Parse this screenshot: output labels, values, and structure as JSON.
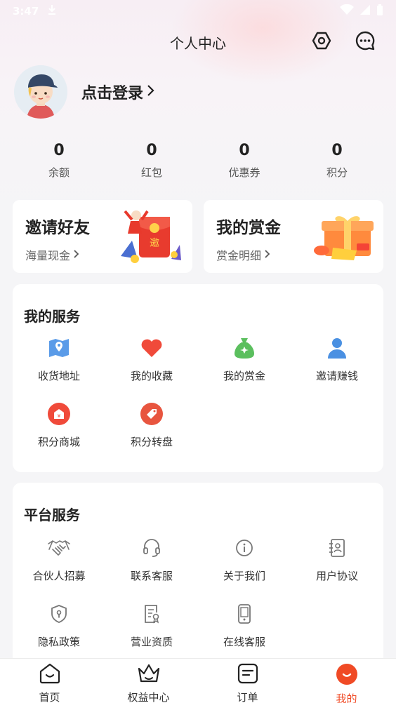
{
  "status_bar": {
    "time": "3:47"
  },
  "header": {
    "title": "个人中心",
    "settings_icon": "settings-hexagon-icon",
    "message_icon": "chat-bubble-icon"
  },
  "profile": {
    "login_text": "点击登录",
    "chevron": "›"
  },
  "stats": [
    {
      "value": "0",
      "label": "余额"
    },
    {
      "value": "0",
      "label": "红包"
    },
    {
      "value": "0",
      "label": "优惠券"
    },
    {
      "value": "0",
      "label": "积分"
    }
  ],
  "promos": [
    {
      "title": "邀请好友",
      "subtitle": "海量现金",
      "art_text": "邀"
    },
    {
      "title": "我的赏金",
      "subtitle": "赏金明细"
    }
  ],
  "my_services": {
    "title": "我的服务",
    "items": [
      {
        "label": "收货地址",
        "icon": "map-pin-icon"
      },
      {
        "label": "我的收藏",
        "icon": "heart-icon"
      },
      {
        "label": "我的赏金",
        "icon": "money-bag-icon"
      },
      {
        "label": "邀请赚钱",
        "icon": "user-icon"
      },
      {
        "label": "积分商城",
        "icon": "store-icon"
      },
      {
        "label": "积分转盘",
        "icon": "tag-icon"
      }
    ]
  },
  "platform_services": {
    "title": "平台服务",
    "items": [
      {
        "label": "合伙人招募",
        "icon": "handshake-icon"
      },
      {
        "label": "联系客服",
        "icon": "headset-icon"
      },
      {
        "label": "关于我们",
        "icon": "info-icon"
      },
      {
        "label": "用户协议",
        "icon": "contact-book-icon"
      },
      {
        "label": "隐私政策",
        "icon": "shield-lock-icon"
      },
      {
        "label": "营业资质",
        "icon": "certificate-icon"
      },
      {
        "label": "在线客服",
        "icon": "phone-icon"
      }
    ]
  },
  "tabbar": [
    {
      "label": "首页",
      "icon": "home-icon"
    },
    {
      "label": "权益中心",
      "icon": "crown-icon"
    },
    {
      "label": "订单",
      "icon": "order-icon"
    },
    {
      "label": "我的",
      "icon": "profile-icon"
    }
  ],
  "colors": {
    "accent": "#f04a25",
    "icon_blue": "#4a90e2",
    "icon_red": "#f04a3a",
    "icon_green": "#5bbf5e"
  }
}
